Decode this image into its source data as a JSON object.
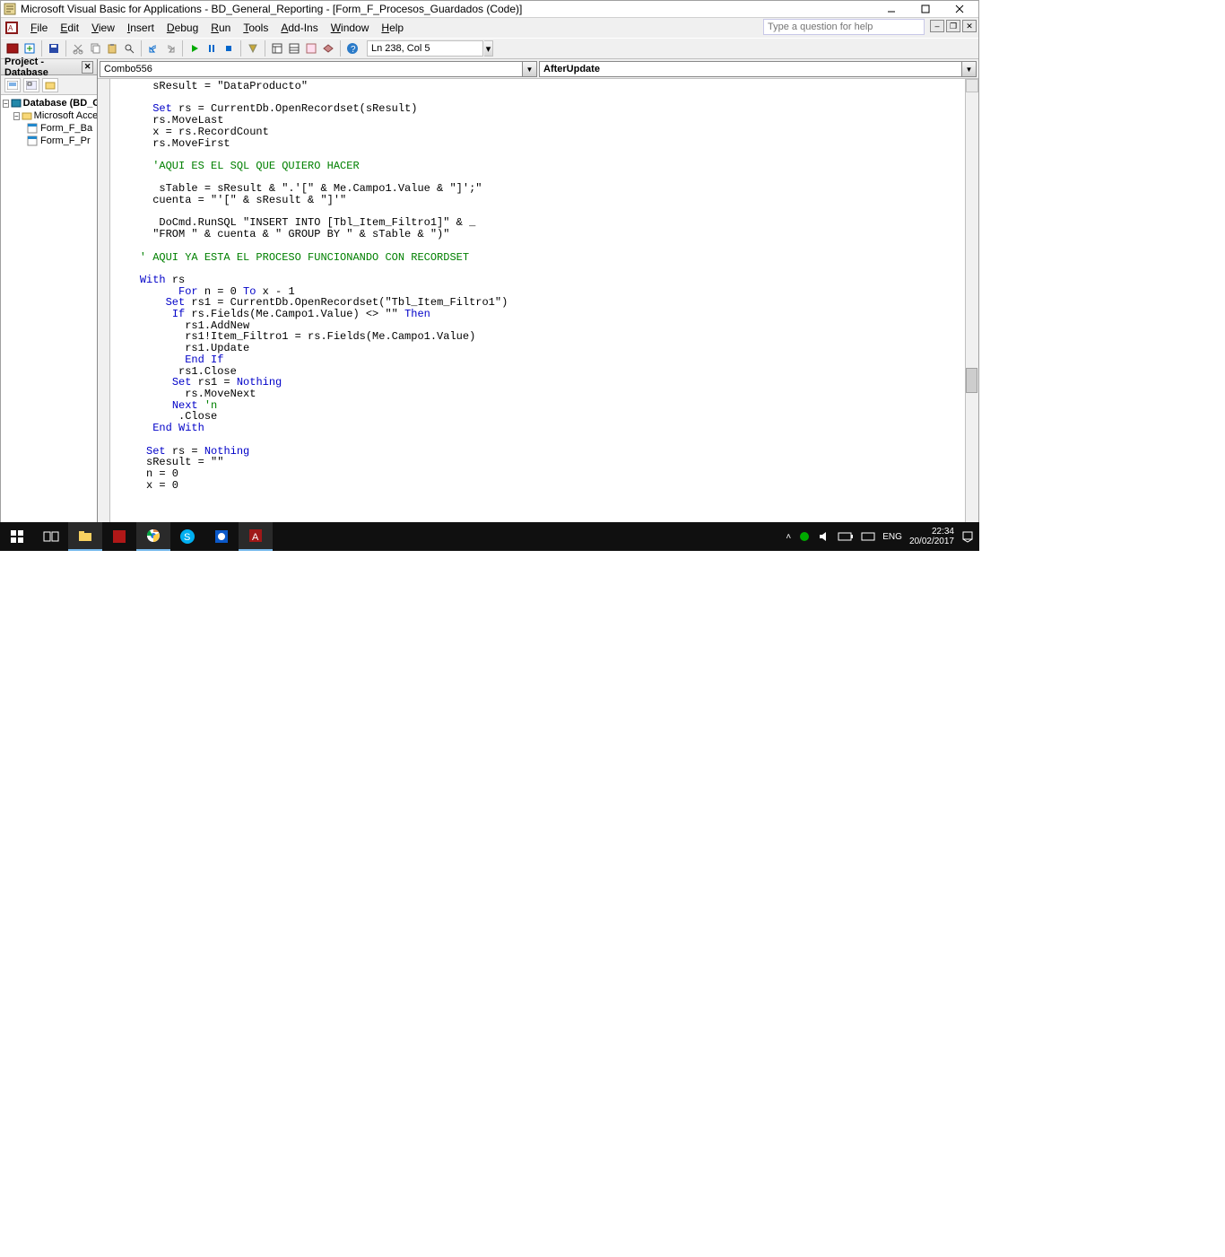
{
  "title": "Microsoft Visual Basic for Applications - BD_General_Reporting - [Form_F_Procesos_Guardados (Code)]",
  "menu": [
    "File",
    "Edit",
    "View",
    "Insert",
    "Debug",
    "Run",
    "Tools",
    "Add-Ins",
    "Window",
    "Help"
  ],
  "help_placeholder": "Type a question for help",
  "status_pos": "Ln 238, Col 5",
  "project": {
    "title": "Project - Database",
    "root": "Database (BD_G",
    "folder": "Microsoft Acce",
    "items": [
      "Form_F_Ba",
      "Form_F_Pr"
    ]
  },
  "dropdowns": {
    "object": "Combo556",
    "proc": "AfterUpdate"
  },
  "code": {
    "l1": "      sResult = \"DataProducto\"",
    "l2": "",
    "l3_a": "      ",
    "l3_kw": "Set",
    "l3_b": " rs = CurrentDb.OpenRecordset(sResult)",
    "l4": "      rs.MoveLast",
    "l5": "      x = rs.RecordCount",
    "l6": "      rs.MoveFirst",
    "l7": "",
    "l8": "      'AQUI ES EL SQL QUE QUIERO HACER",
    "l9": "",
    "l10": "       sTable = sResult & \".'[\" & Me.Campo1.Value & \"]';\"",
    "l11": "      cuenta = \"'[\" & sResult & \"]'\"",
    "l12": "",
    "l13": "       DoCmd.RunSQL \"INSERT INTO [Tbl_Item_Filtro1]\" & _",
    "l14": "      \"FROM \" & cuenta & \" GROUP BY \" & sTable & \")\"",
    "l15": "",
    "l16": "    ' AQUI YA ESTA EL PROCESO FUNCIONANDO CON RECORDSET",
    "l17": "",
    "l18_a": "    ",
    "l18_kw": "With",
    "l18_b": " rs",
    "l19_a": "          ",
    "l19_kw": "For",
    "l19_b": " n = 0 ",
    "l19_kw2": "To",
    "l19_c": " x - 1",
    "l20_a": "        ",
    "l20_kw": "Set",
    "l20_b": " rs1 = CurrentDb.OpenRecordset(\"Tbl_Item_Filtro1\")",
    "l21_a": "         ",
    "l21_kw": "If",
    "l21_b": " rs.Fields(Me.Campo1.Value) <> \"\" ",
    "l21_kw2": "Then",
    "l22": "           rs1.AddNew",
    "l23": "           rs1!Item_Filtro1 = rs.Fields(Me.Campo1.Value)",
    "l24": "           rs1.Update",
    "l25_a": "           ",
    "l25_kw": "End If",
    "l26": "          rs1.Close",
    "l27_a": "         ",
    "l27_kw": "Set",
    "l27_b": " rs1 = ",
    "l27_kw2": "Nothing",
    "l28": "           rs.MoveNext",
    "l29_a": "         ",
    "l29_kw": "Next ",
    "l29_cm": "'n",
    "l30": "          .Close",
    "l31_a": "      ",
    "l31_kw": "End With",
    "l32": "",
    "l33_a": "     ",
    "l33_kw": "Set",
    "l33_b": " rs = ",
    "l33_kw2": "Nothing",
    "l34": "     sResult = \"\"",
    "l35": "     n = 0",
    "l36": "     x = 0"
  },
  "tray": {
    "lang": "ENG",
    "time": "22:34",
    "date": "20/02/2017"
  }
}
